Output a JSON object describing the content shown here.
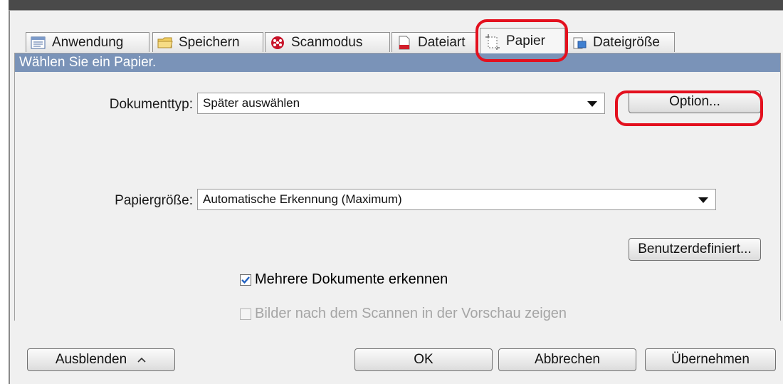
{
  "tabs": [
    {
      "label": "Anwendung",
      "icon": "application-list-icon"
    },
    {
      "label": "Speichern",
      "icon": "folder-icon"
    },
    {
      "label": "Scanmodus",
      "icon": "scanmode-dots-icon"
    },
    {
      "label": "Dateiart",
      "icon": "document-red-icon"
    },
    {
      "label": "Papier",
      "icon": "paper-crop-icon",
      "active": true
    },
    {
      "label": "Dateigröße",
      "icon": "filesize-icon"
    }
  ],
  "banner": "Wählen Sie ein Papier.",
  "dokumenttyp": {
    "label": "Dokumenttyp:",
    "value": "Später auswählen"
  },
  "option_button": "Option...",
  "papiergroesse": {
    "label": "Papiergröße:",
    "value": "Automatische Erkennung (Maximum)"
  },
  "custom_button": "Benutzerdefiniert...",
  "checkboxes": {
    "multi_docs": {
      "label": "Mehrere Dokumente erkennen",
      "checked": true
    },
    "preview": {
      "label": "Bilder nach dem Scannen in der Vorschau zeigen",
      "checked": false,
      "disabled": true
    }
  },
  "footer": {
    "hide": "Ausblenden",
    "ok": "OK",
    "cancel": "Abbrechen",
    "apply": "Übernehmen"
  },
  "colors": {
    "highlight": "#e3101e",
    "banner": "#7a93b8",
    "checkmark": "#1f5fbf"
  }
}
